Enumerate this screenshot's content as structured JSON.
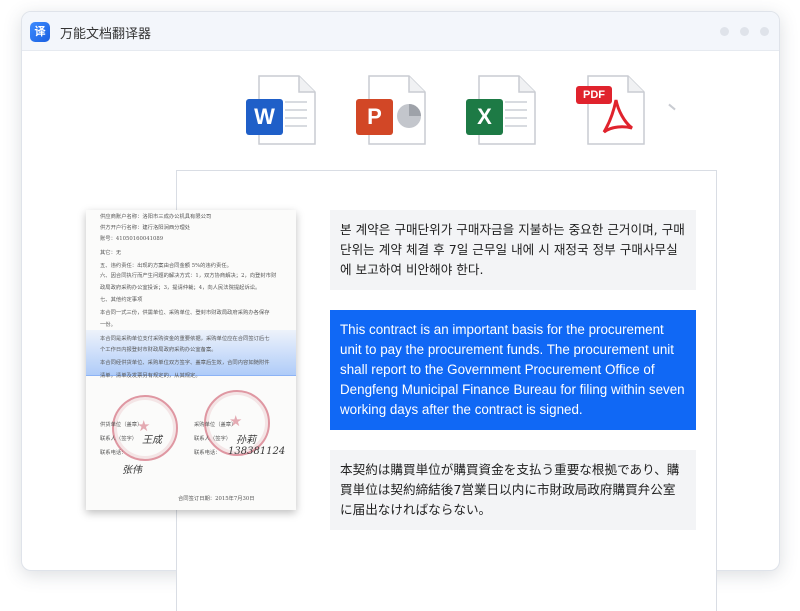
{
  "app": {
    "title": "万能文档翻译器",
    "logo_letter": "译"
  },
  "file_types": [
    {
      "name": "word",
      "badge": "W",
      "color": "#1f5fc8"
    },
    {
      "name": "ppt",
      "badge": "P",
      "color": "#d24726"
    },
    {
      "name": "excel",
      "badge": "X",
      "color": "#1d7a45"
    },
    {
      "name": "pdf",
      "badge": "PDF",
      "color": "#e0232d"
    }
  ],
  "scan_doc": {
    "lines": [
      "供应商账户名称：洛阳市三成办公机具有限公司",
      "供方开户行名称：建行洛阳涧西分理处",
      "账号：41050160041089",
      "其它：无",
      "五、违约责任：出现的方案由合同金额 5%的违约责任。",
      "六、因合同执行而产生问题的解决方式：1，双方协商解决；2，向登封市财",
      "政局政府采购办公室投诉；3，提请仲裁；4，向人民法院提起诉讼。",
      "七、其他约定事项",
      "本合同一式三份，供需单位、采购单位、登封市财政局政府采购办各保存",
      "一份。",
      "本合同是采购单位支付采购资金的重要依据，采购单位应在合同签订后七",
      "个工作日内报登封市财政局政府采购办公室备案。",
      "本合同经供货单位、采购单位双方签字、盖章后生效，合同内容如随附件",
      "清单，清单及发票另有规定的，从其规定。",
      "供货单位（盖章）",
      "采购单位（盖章）",
      "联系人（签字）",
      "联系电话：",
      "合同签订日期：2015年7月30日"
    ],
    "signatures": [
      "王成",
      "孙莉",
      "138381124",
      "张伟"
    ]
  },
  "translations": {
    "korean": "본 계약은 구매단위가 구매자금을 지불하는 중요한 근거이며, 구매단위는 계약 체결 후 7일 근무일 내에 시 재정국 정부 구매사무실에 보고하여 비안해야 한다.",
    "english": "This contract is an important basis for the procurement unit to pay the procurement funds. The procurement unit shall report to the Government Procurement Office of Dengfeng Municipal Finance Bureau for filing within seven working days after the contract is signed.",
    "japanese": "本契約は購買単位が購買資金を支払う重要な根拠であり、購買単位は契約締結後7営業日以内に市財政局政府購買弁公室に届出なければならない。"
  },
  "colors": {
    "accent": "#1068f5",
    "title_bar": "#f3f6fb"
  }
}
